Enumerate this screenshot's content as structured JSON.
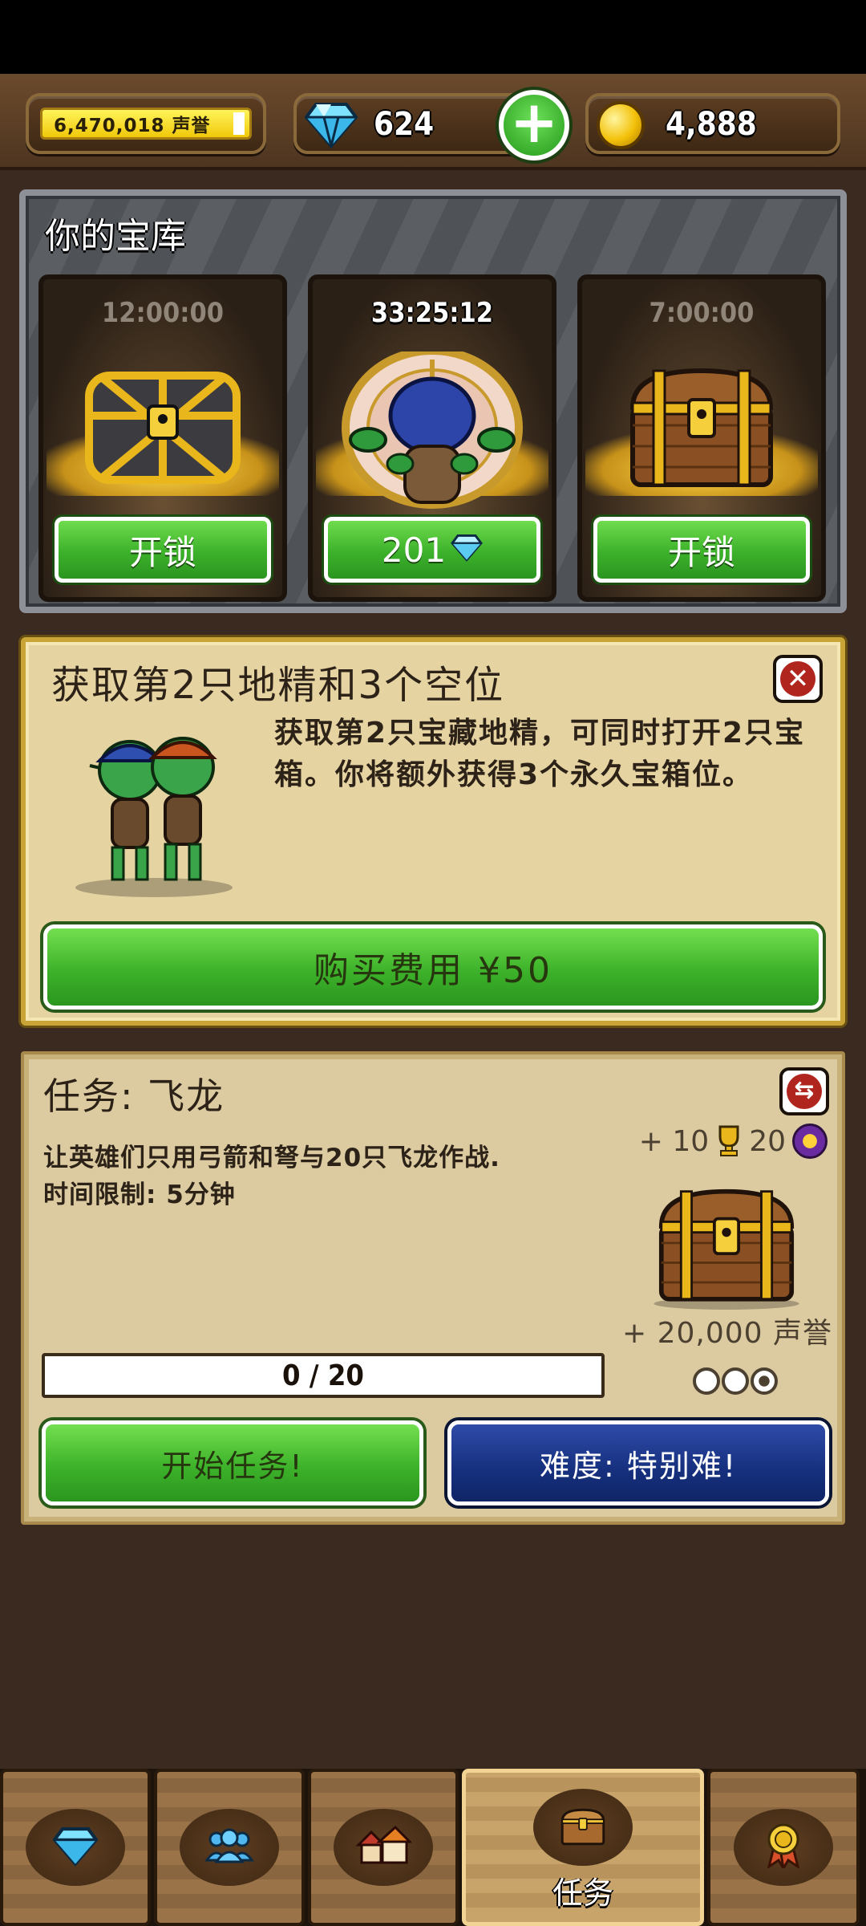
{
  "top_bar": {
    "fame_value": "6,470,018 声誉",
    "gems": "624",
    "coins": "4,888",
    "icons": [
      "diamond-icon",
      "plus-icon",
      "gold-coin-icon"
    ]
  },
  "vault": {
    "title": "你的宝库",
    "slots": [
      {
        "timer": "12:00:00",
        "button_label": "开锁",
        "chest": "iron-chest"
      },
      {
        "timer": "33:25:12",
        "button_label": "201",
        "button_icon": "diamond-icon",
        "chest": "goblin-opening-chest"
      },
      {
        "timer": "7:00:00",
        "button_label": "开锁",
        "chest": "wooden-chest"
      }
    ]
  },
  "offer": {
    "title": "获取第2只地精和3个空位",
    "description": "获取第2只宝藏地精，可同时打开2只宝箱。你将额外获得3个永久宝箱位。",
    "buy_label": "购买费用 ¥50"
  },
  "mission": {
    "title": "任务: 飞龙",
    "description_line1": "让英雄们只用弓箭和弩与20只飞龙作战.",
    "description_line2": "时间限制: 5分钟",
    "reward_trophies": "+ 10",
    "reward_ribbons": "20",
    "reward_fame": "+ 20,000 声誉",
    "difficulty_filled": 1,
    "difficulty_total": 3,
    "progress_text": "0 / 20",
    "progress_fraction": 0,
    "start_label": "开始任务!",
    "difficulty_label": "难度: 特别难!"
  },
  "bottom_nav": {
    "tabs": [
      {
        "icon": "diamond-icon",
        "label": ""
      },
      {
        "icon": "heroes-icon",
        "label": ""
      },
      {
        "icon": "village-icon",
        "label": ""
      },
      {
        "icon": "chest-icon",
        "label": "任务",
        "active": true
      },
      {
        "icon": "medal-icon",
        "label": ""
      }
    ]
  },
  "colors": {
    "accent_green": "#3db22a",
    "difficulty_blue": "#16307e",
    "panel_parchment": "#e6d3a2",
    "close_red": "#b0261e"
  }
}
